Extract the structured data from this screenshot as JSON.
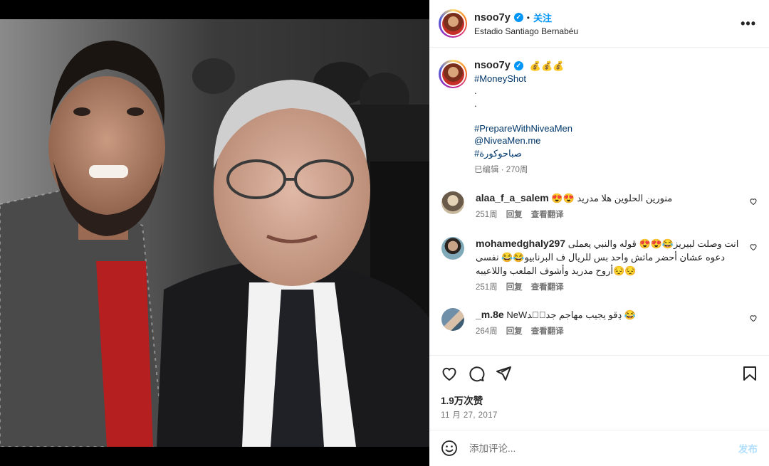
{
  "post": {
    "username": "nsoo7y",
    "verified_mark": "✓",
    "separator": "•",
    "follow_label": "关注",
    "location": "Estadio Santiago Bernabéu",
    "more_label": "•••"
  },
  "caption": {
    "username": "nsoo7y",
    "emojis": "💰💰💰",
    "lines": [
      "#MoneyShot",
      ".",
      ".",
      "",
      "#PrepareWithNiveaMen",
      "@NiveaMen.me",
      "#صباحوكورة"
    ],
    "meta": "已编辑 · 270周"
  },
  "comments": [
    {
      "username": "alaa_f_a_salem",
      "text": "😍😍 منورين الحلوين هلا مدريد",
      "time": "251周",
      "reply": "回复",
      "translate": "查看翻译"
    },
    {
      "username": "mohamedghaly297",
      "text": "انت وصلت لبيريز😂😍😍 قوله والنبي يعملى دعوه عشان أحضر ماتش واحد بس للريال ف البرنابيو😂😂 نفسى أروح مدريد وأشوف الملعب واللاعيبه😔😔",
      "time": "251周",
      "reply": "回复",
      "translate": "查看翻译"
    },
    {
      "username": "_m.8e",
      "text": "NeWڍقو يجيب مهاجم جديۣد 😂",
      "time": "264周",
      "reply": "回复",
      "translate": "查看翻译"
    }
  ],
  "icons": {
    "like": "heart-icon",
    "comment": "comment-icon",
    "share": "share-icon",
    "save": "bookmark-icon",
    "emoji": "emoji-icon",
    "more": "more-icon"
  },
  "likes": "1.9万次赞",
  "date": "11 月 27, 2017",
  "add_comment": {
    "placeholder": "添加评论...",
    "post_label": "发布"
  },
  "colors": {
    "accent": "#0095f6",
    "hashtag": "#00376b",
    "muted": "#737373",
    "post_disabled": "#b2dffc"
  }
}
